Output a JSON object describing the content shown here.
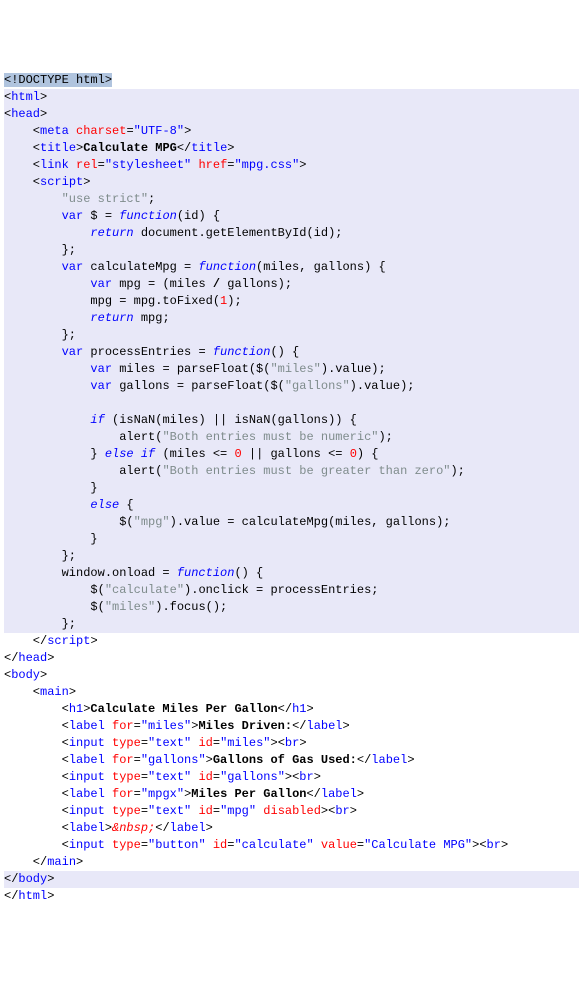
{
  "lines": [
    {
      "sel": "doctype",
      "parts": [
        {
          "c": "sel-doctype",
          "t": "<!"
        },
        {
          "c": "sel-doctype",
          "t": "DOCTYPE html"
        },
        {
          "c": "sel-doctype",
          "t": ">"
        }
      ]
    },
    {
      "sel": "line",
      "parts": [
        {
          "t": "<"
        },
        {
          "c": "tag",
          "t": "html"
        },
        {
          "t": ">"
        }
      ]
    },
    {
      "sel": "line",
      "parts": [
        {
          "t": "<"
        },
        {
          "c": "tag",
          "t": "head"
        },
        {
          "t": ">"
        }
      ]
    },
    {
      "sel": "line",
      "parts": [
        {
          "t": "    <"
        },
        {
          "c": "tag",
          "t": "meta"
        },
        {
          "t": " "
        },
        {
          "c": "attr",
          "t": "charset"
        },
        {
          "t": "="
        },
        {
          "c": "val",
          "t": "\"UTF-8\""
        },
        {
          "t": ">"
        }
      ]
    },
    {
      "sel": "line",
      "parts": [
        {
          "t": "    <"
        },
        {
          "c": "tag",
          "t": "title"
        },
        {
          "t": ">"
        },
        {
          "b": true,
          "t": "Calculate MPG"
        },
        {
          "t": "</"
        },
        {
          "c": "tag",
          "t": "title"
        },
        {
          "t": ">"
        }
      ]
    },
    {
      "sel": "line",
      "parts": [
        {
          "t": "    <"
        },
        {
          "c": "tag",
          "t": "link"
        },
        {
          "t": " "
        },
        {
          "c": "attr",
          "t": "rel"
        },
        {
          "t": "="
        },
        {
          "c": "val",
          "t": "\"stylesheet\""
        },
        {
          "t": " "
        },
        {
          "c": "attr",
          "t": "href"
        },
        {
          "t": "="
        },
        {
          "c": "val",
          "t": "\"mpg.css\""
        },
        {
          "t": ">"
        }
      ]
    },
    {
      "sel": "line",
      "parts": [
        {
          "t": "    <"
        },
        {
          "c": "tag",
          "t": "script"
        },
        {
          "t": ">"
        }
      ]
    },
    {
      "sel": "line",
      "parts": [
        {
          "t": "        "
        },
        {
          "c": "str",
          "t": "\"use strict\""
        },
        {
          "t": ";"
        }
      ]
    },
    {
      "sel": "line",
      "parts": [
        {
          "t": "        "
        },
        {
          "c": "kw",
          "t": "var"
        },
        {
          "t": " $ = "
        },
        {
          "c": "kwi",
          "t": "function"
        },
        {
          "t": "(id) {"
        }
      ]
    },
    {
      "sel": "line",
      "parts": [
        {
          "t": "            "
        },
        {
          "c": "kwi",
          "t": "return"
        },
        {
          "t": " document.getElementById(id);"
        }
      ]
    },
    {
      "sel": "line",
      "parts": [
        {
          "t": "        };"
        }
      ]
    },
    {
      "sel": "line",
      "parts": [
        {
          "t": "        "
        },
        {
          "c": "kw",
          "t": "var"
        },
        {
          "t": " calculateMpg = "
        },
        {
          "c": "kwi",
          "t": "function"
        },
        {
          "t": "(miles, gallons) {"
        }
      ]
    },
    {
      "sel": "line",
      "parts": [
        {
          "t": "            "
        },
        {
          "c": "kw",
          "t": "var"
        },
        {
          "t": " mpg = (miles "
        },
        {
          "b": true,
          "t": "/"
        },
        {
          "t": " gallons);"
        }
      ]
    },
    {
      "sel": "line",
      "parts": [
        {
          "t": "            mpg = mpg.toFixed("
        },
        {
          "c": "num",
          "t": "1"
        },
        {
          "t": ");"
        }
      ]
    },
    {
      "sel": "line",
      "parts": [
        {
          "t": "            "
        },
        {
          "c": "kwi",
          "t": "return"
        },
        {
          "t": " mpg;"
        }
      ]
    },
    {
      "sel": "line",
      "parts": [
        {
          "t": "        };"
        }
      ]
    },
    {
      "sel": "line",
      "parts": [
        {
          "t": "        "
        },
        {
          "c": "kw",
          "t": "var"
        },
        {
          "t": " processEntries = "
        },
        {
          "c": "kwi",
          "t": "function"
        },
        {
          "t": "() {"
        }
      ]
    },
    {
      "sel": "line",
      "parts": [
        {
          "t": "            "
        },
        {
          "c": "kw",
          "t": "var"
        },
        {
          "t": " miles = parseFloat($("
        },
        {
          "c": "str",
          "t": "\"miles\""
        },
        {
          "t": ").value);"
        }
      ]
    },
    {
      "sel": "line",
      "parts": [
        {
          "t": "            "
        },
        {
          "c": "kw",
          "t": "var"
        },
        {
          "t": " gallons = parseFloat($("
        },
        {
          "c": "str",
          "t": "\"gallons\""
        },
        {
          "t": ").value);"
        }
      ]
    },
    {
      "sel": "line",
      "parts": [
        {
          "t": ""
        }
      ]
    },
    {
      "sel": "line",
      "parts": [
        {
          "t": "            "
        },
        {
          "c": "kwi",
          "t": "if"
        },
        {
          "t": " (isNaN(miles) || isNaN(gallons)) {"
        }
      ]
    },
    {
      "sel": "line",
      "parts": [
        {
          "t": "                alert("
        },
        {
          "c": "str",
          "t": "\"Both entries must be numeric\""
        },
        {
          "t": ");"
        }
      ]
    },
    {
      "sel": "line",
      "parts": [
        {
          "t": "            } "
        },
        {
          "c": "kwi",
          "t": "else if"
        },
        {
          "t": " (miles <= "
        },
        {
          "c": "num",
          "t": "0"
        },
        {
          "t": " || gallons <= "
        },
        {
          "c": "num",
          "t": "0"
        },
        {
          "t": ") {"
        }
      ]
    },
    {
      "sel": "line",
      "parts": [
        {
          "t": "                alert("
        },
        {
          "c": "str",
          "t": "\"Both entries must be greater than zero\""
        },
        {
          "t": ");"
        }
      ]
    },
    {
      "sel": "line",
      "parts": [
        {
          "t": "            }"
        }
      ]
    },
    {
      "sel": "line",
      "parts": [
        {
          "t": "            "
        },
        {
          "c": "kwi",
          "t": "else"
        },
        {
          "t": " {"
        }
      ]
    },
    {
      "sel": "line",
      "parts": [
        {
          "t": "                $("
        },
        {
          "c": "str",
          "t": "\"mpg\""
        },
        {
          "t": ").value = calculateMpg(miles, gallons);"
        }
      ]
    },
    {
      "sel": "line",
      "parts": [
        {
          "t": "            }"
        }
      ]
    },
    {
      "sel": "line",
      "parts": [
        {
          "t": "        };"
        }
      ]
    },
    {
      "sel": "line",
      "parts": [
        {
          "t": "        window.onload = "
        },
        {
          "c": "kwi",
          "t": "function"
        },
        {
          "t": "() {"
        }
      ]
    },
    {
      "sel": "line",
      "parts": [
        {
          "t": "            $("
        },
        {
          "c": "str",
          "t": "\"calculate\""
        },
        {
          "t": ").onclick = processEntries;"
        }
      ]
    },
    {
      "sel": "line",
      "parts": [
        {
          "t": "            $("
        },
        {
          "c": "str",
          "t": "\"miles\""
        },
        {
          "t": ").focus();"
        }
      ]
    },
    {
      "sel": "line",
      "parts": [
        {
          "t": "        };"
        }
      ]
    },
    {
      "sel": "none",
      "parts": [
        {
          "t": "    </"
        },
        {
          "c": "tag",
          "t": "script"
        },
        {
          "t": ">"
        }
      ]
    },
    {
      "sel": "none",
      "parts": [
        {
          "t": "</"
        },
        {
          "c": "tag",
          "t": "head"
        },
        {
          "t": ">"
        }
      ]
    },
    {
      "sel": "none",
      "parts": [
        {
          "t": "<"
        },
        {
          "c": "tag",
          "t": "body"
        },
        {
          "t": ">"
        }
      ]
    },
    {
      "sel": "none",
      "parts": [
        {
          "t": "    <"
        },
        {
          "c": "tag",
          "t": "main"
        },
        {
          "t": ">"
        }
      ]
    },
    {
      "sel": "none",
      "parts": [
        {
          "t": "        <"
        },
        {
          "c": "tag",
          "t": "h1"
        },
        {
          "t": ">"
        },
        {
          "b": true,
          "t": "Calculate Miles Per Gallon"
        },
        {
          "t": "</"
        },
        {
          "c": "tag",
          "t": "h1"
        },
        {
          "t": ">"
        }
      ]
    },
    {
      "sel": "none",
      "parts": [
        {
          "t": "        <"
        },
        {
          "c": "tag",
          "t": "label"
        },
        {
          "t": " "
        },
        {
          "c": "attr",
          "t": "for"
        },
        {
          "t": "="
        },
        {
          "c": "val",
          "t": "\"miles\""
        },
        {
          "t": ">"
        },
        {
          "b": true,
          "t": "Miles Driven:"
        },
        {
          "t": "</"
        },
        {
          "c": "tag",
          "t": "label"
        },
        {
          "t": ">"
        }
      ]
    },
    {
      "sel": "none",
      "parts": [
        {
          "t": "        <"
        },
        {
          "c": "tag",
          "t": "input"
        },
        {
          "t": " "
        },
        {
          "c": "attr",
          "t": "type"
        },
        {
          "t": "="
        },
        {
          "c": "val",
          "t": "\"text\""
        },
        {
          "t": " "
        },
        {
          "c": "attr",
          "t": "id"
        },
        {
          "t": "="
        },
        {
          "c": "val",
          "t": "\"miles\""
        },
        {
          "t": "><"
        },
        {
          "c": "tag",
          "t": "br"
        },
        {
          "t": ">"
        }
      ]
    },
    {
      "sel": "none",
      "parts": [
        {
          "t": "        <"
        },
        {
          "c": "tag",
          "t": "label"
        },
        {
          "t": " "
        },
        {
          "c": "attr",
          "t": "for"
        },
        {
          "t": "="
        },
        {
          "c": "val",
          "t": "\"gallons\""
        },
        {
          "t": ">"
        },
        {
          "b": true,
          "t": "Gallons of Gas Used:"
        },
        {
          "t": "</"
        },
        {
          "c": "tag",
          "t": "label"
        },
        {
          "t": ">"
        }
      ]
    },
    {
      "sel": "none",
      "parts": [
        {
          "t": "        <"
        },
        {
          "c": "tag",
          "t": "input"
        },
        {
          "t": " "
        },
        {
          "c": "attr",
          "t": "type"
        },
        {
          "t": "="
        },
        {
          "c": "val",
          "t": "\"text\""
        },
        {
          "t": " "
        },
        {
          "c": "attr",
          "t": "id"
        },
        {
          "t": "="
        },
        {
          "c": "val",
          "t": "\"gallons\""
        },
        {
          "t": "><"
        },
        {
          "c": "tag",
          "t": "br"
        },
        {
          "t": ">"
        }
      ]
    },
    {
      "sel": "none",
      "parts": [
        {
          "t": "        <"
        },
        {
          "c": "tag",
          "t": "label"
        },
        {
          "t": " "
        },
        {
          "c": "attr",
          "t": "for"
        },
        {
          "t": "="
        },
        {
          "c": "val",
          "t": "\"mpgx\""
        },
        {
          "t": ">"
        },
        {
          "b": true,
          "t": "Miles Per Gallon"
        },
        {
          "t": "</"
        },
        {
          "c": "tag",
          "t": "label"
        },
        {
          "t": ">"
        }
      ]
    },
    {
      "sel": "none",
      "parts": [
        {
          "t": "        <"
        },
        {
          "c": "tag",
          "t": "input"
        },
        {
          "t": " "
        },
        {
          "c": "attr",
          "t": "type"
        },
        {
          "t": "="
        },
        {
          "c": "val",
          "t": "\"text\""
        },
        {
          "t": " "
        },
        {
          "c": "attr",
          "t": "id"
        },
        {
          "t": "="
        },
        {
          "c": "val",
          "t": "\"mpg\""
        },
        {
          "t": " "
        },
        {
          "c": "attr",
          "t": "disabled"
        },
        {
          "t": "><"
        },
        {
          "c": "tag",
          "t": "br"
        },
        {
          "t": ">"
        }
      ]
    },
    {
      "sel": "none",
      "parts": [
        {
          "t": "        <"
        },
        {
          "c": "tag",
          "t": "label"
        },
        {
          "t": ">"
        },
        {
          "c": "ent",
          "t": "&nbsp;"
        },
        {
          "t": "</"
        },
        {
          "c": "tag",
          "t": "label"
        },
        {
          "t": ">"
        }
      ]
    },
    {
      "sel": "none",
      "parts": [
        {
          "t": "        <"
        },
        {
          "c": "tag",
          "t": "input"
        },
        {
          "t": " "
        },
        {
          "c": "attr",
          "t": "type"
        },
        {
          "t": "="
        },
        {
          "c": "val",
          "t": "\"button\""
        },
        {
          "t": " "
        },
        {
          "c": "attr",
          "t": "id"
        },
        {
          "t": "="
        },
        {
          "c": "val",
          "t": "\"calculate\""
        },
        {
          "t": " "
        },
        {
          "c": "attr",
          "t": "value"
        },
        {
          "t": "="
        },
        {
          "c": "val",
          "t": "\"Calculate MPG\""
        },
        {
          "t": "><"
        },
        {
          "c": "tag",
          "t": "br"
        },
        {
          "t": ">"
        }
      ]
    },
    {
      "sel": "none",
      "parts": [
        {
          "t": "    </"
        },
        {
          "c": "tag",
          "t": "main"
        },
        {
          "t": ">"
        }
      ]
    },
    {
      "sel": "line",
      "parts": [
        {
          "t": "</"
        },
        {
          "c": "tag",
          "t": "body"
        },
        {
          "t": ">"
        }
      ]
    },
    {
      "sel": "none",
      "parts": [
        {
          "t": "</"
        },
        {
          "c": "tag",
          "t": "html"
        },
        {
          "t": ">"
        }
      ]
    }
  ]
}
